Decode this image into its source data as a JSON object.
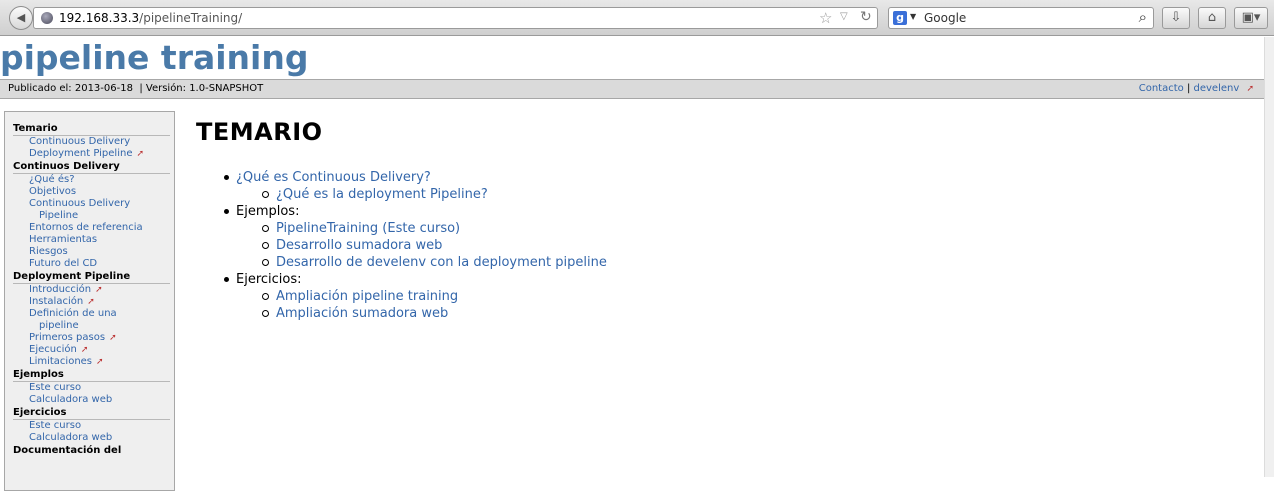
{
  "browser": {
    "url_host": "192.168.33.3",
    "url_path": "/pipelineTraining/",
    "search_placeholder": "Google"
  },
  "site": {
    "title": "pipeline training",
    "published": "Publicado el: 2013-06-18",
    "version": "| Versión: 1.0-SNAPSHOT",
    "contact": "Contacto",
    "separator": "|",
    "develenv": "develenv"
  },
  "sidebar": {
    "sections": [
      {
        "title": "Temario",
        "items": [
          "Continuous Delivery",
          "Deployment Pipeline"
        ]
      },
      {
        "title": "Continuos Delivery",
        "items": [
          "¿Qué és?",
          "Objetivos",
          "Continuous Delivery",
          "Pipeline",
          "Entornos de referencia",
          "Herramientas",
          "Riesgos",
          "Futuro del CD"
        ]
      },
      {
        "title": "Deployment Pipeline",
        "items": [
          "Introducción",
          "Instalación",
          "Definición de una",
          "pipeline",
          "Primeros pasos",
          "Ejecución",
          "Limitaciones"
        ]
      },
      {
        "title": "Ejemplos",
        "items": [
          "Este curso",
          "Calculadora web"
        ]
      },
      {
        "title": "Ejercicios",
        "items": [
          "Este curso",
          "Calculadora web"
        ]
      },
      {
        "title": "Documentación del"
      }
    ]
  },
  "main": {
    "title": "TEMARIO",
    "toc": [
      {
        "label": "¿Qué es Continuous Delivery?",
        "children": [
          "¿Qué es la deployment Pipeline?"
        ]
      },
      {
        "label": "Ejemplos:",
        "children": [
          "PipelineTraining (Este curso)",
          "Desarrollo sumadora web",
          "Desarrollo de develenv con la deployment pipeline"
        ]
      },
      {
        "label": "Ejercicios:",
        "children": [
          "Ampliación pipeline training",
          "Ampliación sumadora web"
        ]
      }
    ]
  },
  "icons": {
    "back": "back-arrow-icon",
    "globe": "globe-icon",
    "star": "bookmark-star-icon",
    "reload": "reload-icon",
    "search_engine": "google-icon",
    "magnifier": "magnifier-icon",
    "download": "download-icon",
    "home": "home-icon",
    "menu": "menu-icon",
    "external": "external-link-icon"
  }
}
